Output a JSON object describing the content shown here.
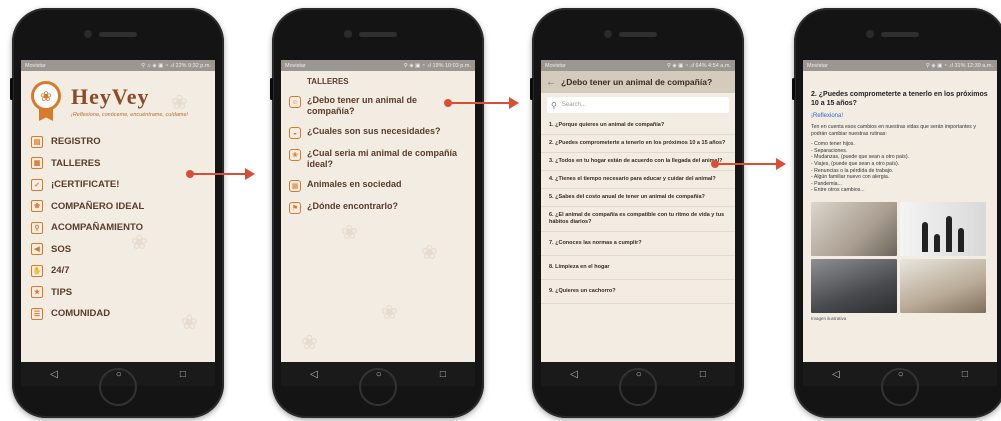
{
  "screens": {
    "home": {
      "status_left": "Movistar",
      "status_right": "⚲ ♫ ◈ ▣ ◔ .ıl 22% 9:32 p.m.",
      "logo_title": "HeyVey",
      "logo_tagline": "¡Reflexiona, conóceme, encuéntrame, cuídame!",
      "menu": [
        {
          "label": "REGISTRO",
          "icon": "id-card-icon",
          "glyph": "▤"
        },
        {
          "label": "TALLERES",
          "icon": "book-icon",
          "glyph": "▦"
        },
        {
          "label": "¡CERTIFICATE!",
          "icon": "certificate-icon",
          "glyph": "✓"
        },
        {
          "label": "COMPAÑERO IDEAL",
          "icon": "paw-icon",
          "glyph": "❀"
        },
        {
          "label": "ACOMPAÑAMIENTO",
          "icon": "search-icon",
          "glyph": "⚲"
        },
        {
          "label": "SOS",
          "icon": "megaphone-icon",
          "glyph": "◀"
        },
        {
          "label": "24/7",
          "icon": "hand-icon",
          "glyph": "✋"
        },
        {
          "label": "TIPS",
          "icon": "tips-icon",
          "glyph": "★"
        },
        {
          "label": "COMUNIDAD",
          "icon": "community-icon",
          "glyph": "☰"
        }
      ]
    },
    "talleres": {
      "status_left": "Movistar",
      "status_right": "⚲ ◈ ▣ ◔ .ıl 19% 10:03 p.m.",
      "title": "TALLERES",
      "items": [
        {
          "label": "¿Debo tener un animal de compañía?",
          "icon": "person-icon",
          "glyph": "☺"
        },
        {
          "label": "¿Cuales son sus necesidades?",
          "icon": "food-icon",
          "glyph": "◒"
        },
        {
          "label": "¿Cual seria mi animal de compañía ideal?",
          "icon": "paw-icon",
          "glyph": "❀"
        },
        {
          "label": "Animales en sociedad",
          "icon": "building-icon",
          "glyph": "▦"
        },
        {
          "label": "¿Dónde encontrarlo?",
          "icon": "location-icon",
          "glyph": "⚑"
        }
      ]
    },
    "questions": {
      "status_left": "Movistar",
      "status_right": "⚲ ◈ ▣ ◔ .ıl 64% 4:54 a.m.",
      "title": "¿Debo tener un animal de compañía?",
      "search_placeholder": "Search...",
      "questions": [
        "1. ¿Porque quieres un animal de compañía?",
        "2. ¿Puedes comprometerte a tenerlo en los próximos 10 a 15 años?",
        "3. ¿Todos en tu hogar están de acuerdo con la llegada del animal?",
        "4. ¿Tienes el tiempo necesario para educar y cuidar del animal?",
        "5. ¿Sabes del costo anual de tener un animal de compañía?",
        "6. ¿El animal de compañía es compatible con tu ritmo de vida y tus hábitos diarios?",
        "7. ¿Conoces las normas a cumplir?",
        "8. Limpieza en el hogar",
        "9. ¿Quieres un cachorro?"
      ]
    },
    "detail": {
      "status_left": "Movistar",
      "status_right": "⚲ ◈ ▣ ◔ .ıl 31% 12:39 a.m.",
      "title": "2. ¿Puedes comprometerte a tenerlo en los próximos 10 a 15 años?",
      "reflect_link": "¡Reflexiona!",
      "paragraph": "Ten en cuenta esos cambios en nuestras vidas que serán importantes y podrán cambiar nuestras rutinas:",
      "list": [
        "- Como tener hijos.",
        "- Separaciones.",
        "- Mudanzas, (puede que sean a otro país).",
        "- Viajes, (puede que sean a otro país).",
        "- Renuncias o la pérdida de trabajo.",
        "- Algún familiar nuevo con alergia.",
        "- Pandemia...",
        "- Entre otros cambios..."
      ],
      "caption": "Imagen ilustrativa"
    }
  },
  "navbar": {
    "back": "◁",
    "home": "○",
    "recent": "□"
  },
  "colors": {
    "accent": "#d97a2b",
    "arrow": "#d94f36",
    "text_brown": "#5a3c2a",
    "screen_bg": "#f2ece3"
  }
}
